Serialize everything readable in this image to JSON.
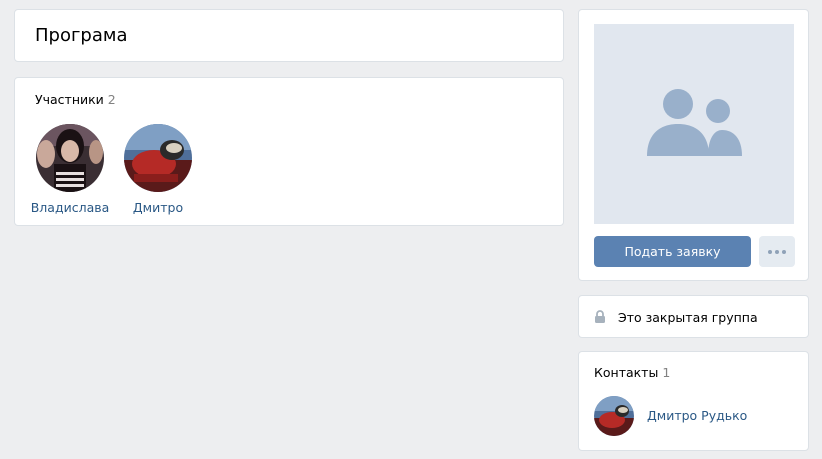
{
  "group": {
    "title": "Програма"
  },
  "members": {
    "label": "Участники",
    "count": "2",
    "items": [
      {
        "name": "Владислава"
      },
      {
        "name": "Дмитро"
      }
    ]
  },
  "sidebar": {
    "join_label": "Подать заявку",
    "closed_label": "Это закрытая группа",
    "contacts": {
      "label": "Контакты",
      "count": "1",
      "items": [
        {
          "name": "Дмитро Рудько"
        }
      ]
    }
  },
  "colors": {
    "link": "#2a5885",
    "button": "#5b82b2",
    "background": "#edeef0",
    "cover": "#e1e7ef"
  },
  "icons": [
    "community-placeholder-icon",
    "more-icon",
    "lock-icon"
  ]
}
